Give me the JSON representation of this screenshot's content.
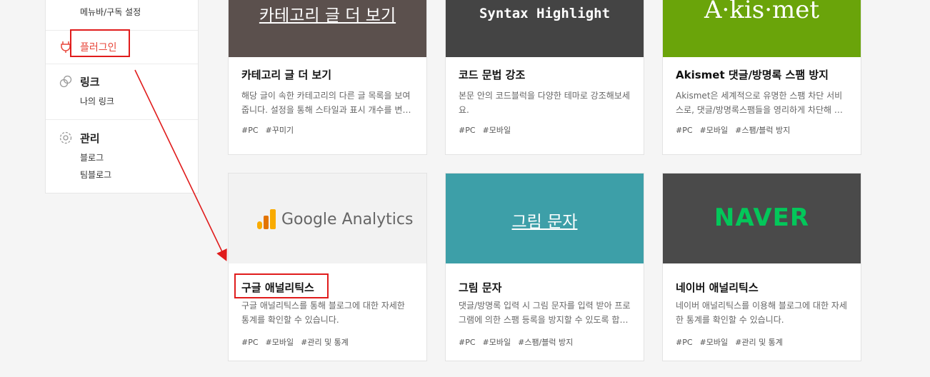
{
  "sidebar": {
    "menu_bar_setting": "메뉴바/구독 설정",
    "plugin": "플러그인",
    "link_title": "링크",
    "my_link": "나의 링크",
    "manage_title": "관리",
    "blog": "블로그",
    "team_blog": "팀블로그"
  },
  "cards": [
    {
      "thumb_text": "카테고리 글 더 보기",
      "title": "카테고리 글 더 보기",
      "desc": "해당 글이 속한 카테고리의 다른 글 목록을 보여줍니다. 설정을 통해 스타일과 표시 개수를 변경할 수 있습니다.",
      "tags": [
        "#PC",
        "#꾸미기"
      ]
    },
    {
      "thumb_text": "Syntax Highlight",
      "title": "코드 문법 강조",
      "desc": "본문 안의 코드블럭을 다양한 테마로 강조해보세요.",
      "tags": [
        "#PC",
        "#모바일"
      ]
    },
    {
      "thumb_text": "A·kis·met",
      "title": "Akismet 댓글/방명록 스팸 방지",
      "desc": "Akismet은 세계적으로 유명한 스팸 차단 서비스로, 댓글/방명록스팸들을 영리하게 차단해 드립니다.",
      "tags": [
        "#PC",
        "#모바일",
        "#스팸/블럭 방지"
      ]
    },
    {
      "thumb_text": "Google Analytics",
      "title": "구글 애널리틱스",
      "desc": "구글 애널리틱스를 통해 블로그에 대한 자세한 통계를 확인할 수 있습니다.",
      "tags": [
        "#PC",
        "#모바일",
        "#관리 및 통계"
      ]
    },
    {
      "thumb_text": "그림 문자",
      "title": "그림 문자",
      "desc": "댓글/방명록 입력 시 그림 문자를 입력 받아 프로그램에 의한 스팸 등록을 방지할 수 있도록 합니다.",
      "tags": [
        "#PC",
        "#모바일",
        "#스팸/블럭 방지"
      ]
    },
    {
      "thumb_text": "NAVER",
      "title": "네이버 애널리틱스",
      "desc": "네이버 애널리틱스를 이용해 블로그에 대한 자세한 통계를 확인할 수 있습니다.",
      "tags": [
        "#PC",
        "#모바일",
        "#관리 및 통계"
      ]
    }
  ],
  "colors": {
    "highlight": "#e01c1c",
    "plugin_red": "#e8473b",
    "akismet_green": "#6aa40a",
    "naver_green": "#03c75a",
    "teal": "#3d9fa8"
  }
}
